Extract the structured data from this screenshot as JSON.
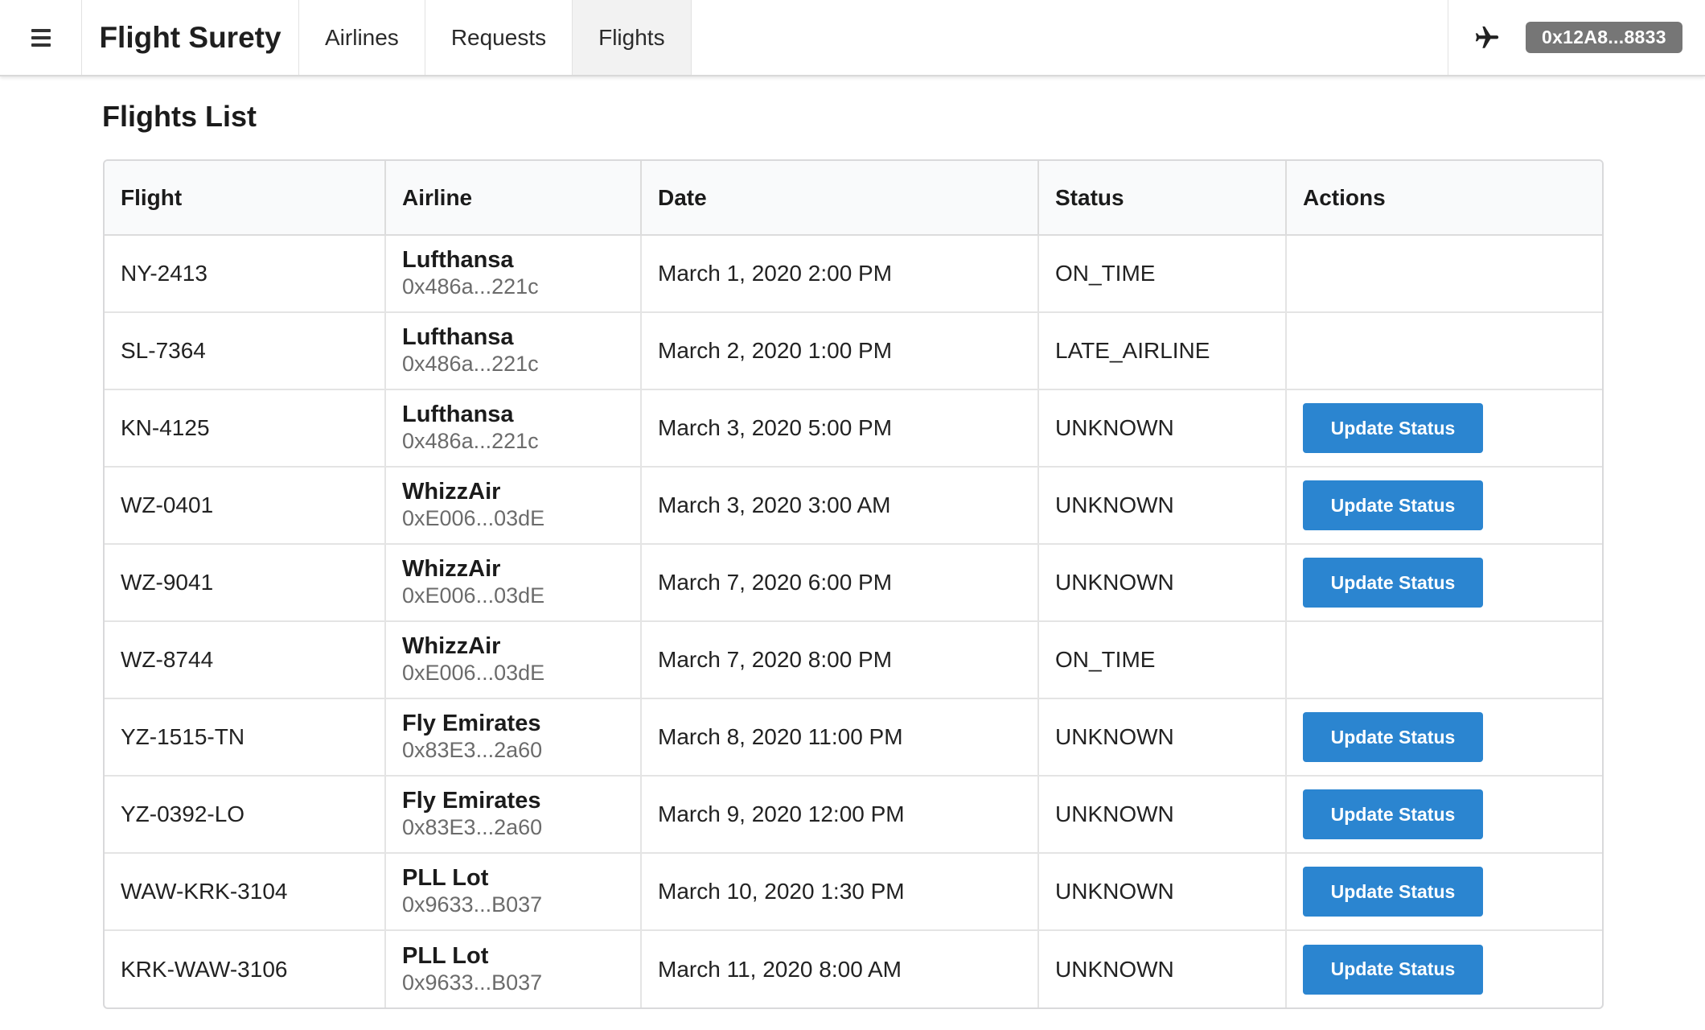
{
  "app": {
    "brand": "Flight Surety",
    "nav": [
      {
        "label": "Airlines",
        "active": false
      },
      {
        "label": "Requests",
        "active": false
      },
      {
        "label": "Flights",
        "active": true
      }
    ],
    "account": "0x12A8...8833",
    "icons": {
      "menu": "hamburger-icon",
      "plane": "airplane-icon"
    }
  },
  "main": {
    "title": "Flights List",
    "columns": [
      "Flight",
      "Airline",
      "Date",
      "Status",
      "Actions"
    ],
    "action_label": "Update Status",
    "accent_color": "#2b85d0",
    "rows": [
      {
        "flight": "NY-2413",
        "airline": "Lufthansa",
        "address": "0x486a...221c",
        "date": "March 1, 2020 2:00 PM",
        "status": "ON_TIME",
        "action": false
      },
      {
        "flight": "SL-7364",
        "airline": "Lufthansa",
        "address": "0x486a...221c",
        "date": "March 2, 2020 1:00 PM",
        "status": "LATE_AIRLINE",
        "action": false
      },
      {
        "flight": "KN-4125",
        "airline": "Lufthansa",
        "address": "0x486a...221c",
        "date": "March 3, 2020 5:00 PM",
        "status": "UNKNOWN",
        "action": true
      },
      {
        "flight": "WZ-0401",
        "airline": "WhizzAir",
        "address": "0xE006...03dE",
        "date": "March 3, 2020 3:00 AM",
        "status": "UNKNOWN",
        "action": true
      },
      {
        "flight": "WZ-9041",
        "airline": "WhizzAir",
        "address": "0xE006...03dE",
        "date": "March 7, 2020 6:00 PM",
        "status": "UNKNOWN",
        "action": true
      },
      {
        "flight": "WZ-8744",
        "airline": "WhizzAir",
        "address": "0xE006...03dE",
        "date": "March 7, 2020 8:00 PM",
        "status": "ON_TIME",
        "action": false
      },
      {
        "flight": "YZ-1515-TN",
        "airline": "Fly Emirates",
        "address": "0x83E3...2a60",
        "date": "March 8, 2020 11:00 PM",
        "status": "UNKNOWN",
        "action": true
      },
      {
        "flight": "YZ-0392-LO",
        "airline": "Fly Emirates",
        "address": "0x83E3...2a60",
        "date": "March 9, 2020 12:00 PM",
        "status": "UNKNOWN",
        "action": true
      },
      {
        "flight": "WAW-KRK-3104",
        "airline": "PLL Lot",
        "address": "0x9633...B037",
        "date": "March 10, 2020 1:30 PM",
        "status": "UNKNOWN",
        "action": true
      },
      {
        "flight": "KRK-WAW-3106",
        "airline": "PLL Lot",
        "address": "0x9633...B037",
        "date": "March 11, 2020 8:00 AM",
        "status": "UNKNOWN",
        "action": true
      }
    ]
  }
}
